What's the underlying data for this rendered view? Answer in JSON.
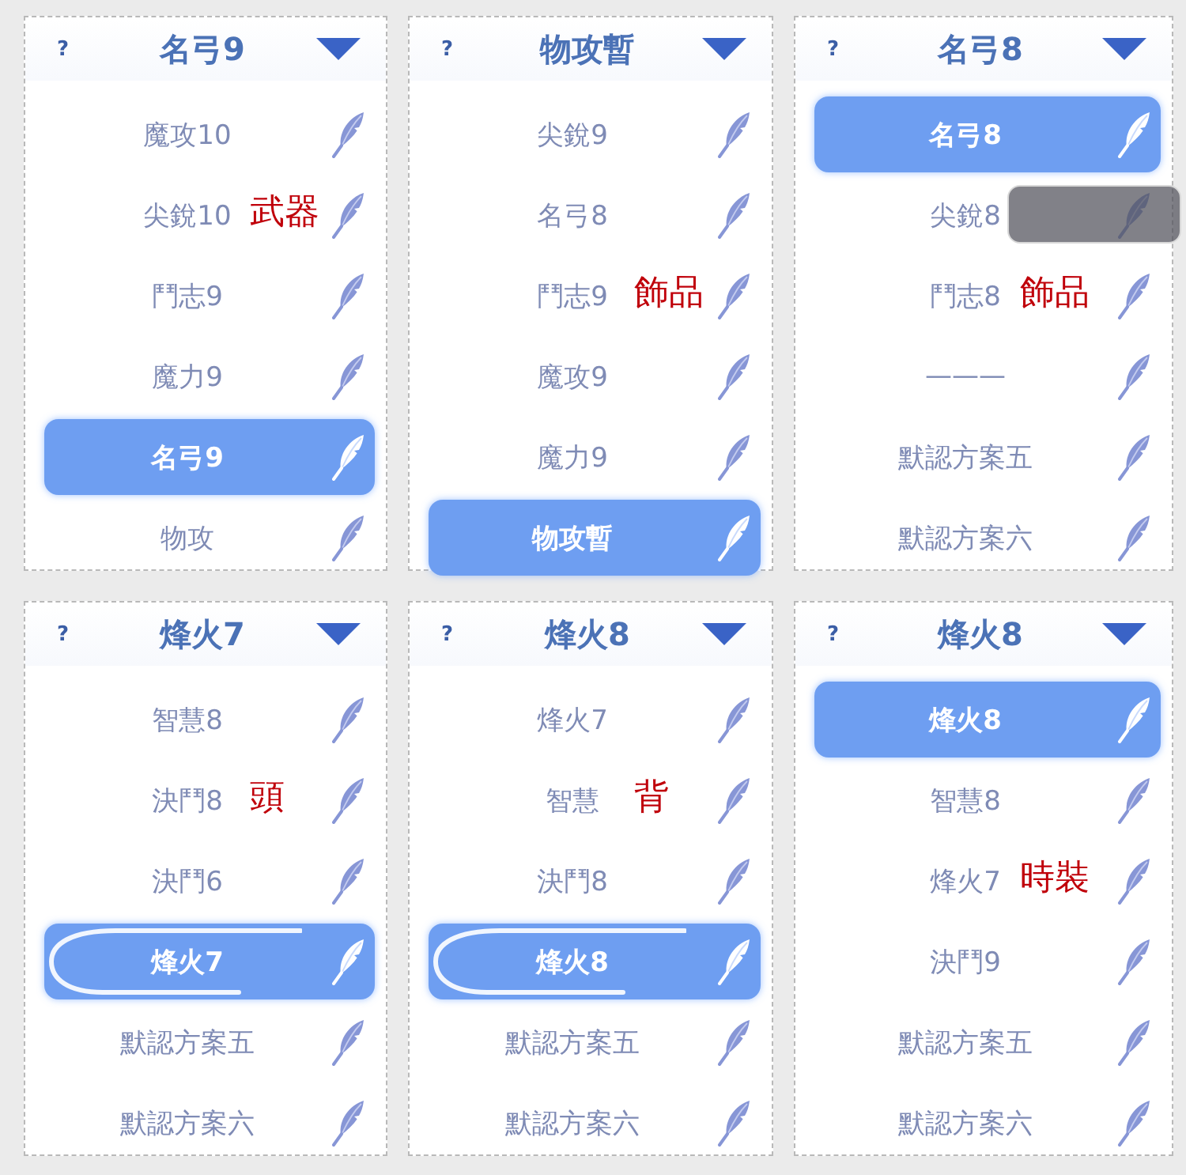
{
  "panels": [
    {
      "help": "?",
      "title": "名弓9",
      "items": [
        {
          "label": "魔攻10",
          "selected": false,
          "shine": false,
          "dragging": false
        },
        {
          "label": "尖銳10",
          "selected": false,
          "shine": false,
          "dragging": false,
          "annotation": "武器"
        },
        {
          "label": "鬥志9",
          "selected": false,
          "shine": false,
          "dragging": false
        },
        {
          "label": "魔力9",
          "selected": false,
          "shine": false,
          "dragging": false
        },
        {
          "label": "名弓9",
          "selected": true,
          "shine": false,
          "dragging": false
        },
        {
          "label": "物攻",
          "selected": false,
          "shine": false,
          "dragging": false
        }
      ]
    },
    {
      "help": "?",
      "title": "物攻暫",
      "items": [
        {
          "label": "尖銳9",
          "selected": false,
          "shine": false,
          "dragging": false
        },
        {
          "label": "名弓8",
          "selected": false,
          "shine": false,
          "dragging": false
        },
        {
          "label": "鬥志9",
          "selected": false,
          "shine": false,
          "dragging": false,
          "annotation": "飾品"
        },
        {
          "label": "魔攻9",
          "selected": false,
          "shine": false,
          "dragging": false
        },
        {
          "label": "魔力9",
          "selected": false,
          "shine": false,
          "dragging": false
        },
        {
          "label": "物攻暫",
          "selected": true,
          "shine": false,
          "dragging": false
        }
      ]
    },
    {
      "help": "?",
      "title": "名弓8",
      "items": [
        {
          "label": "名弓8",
          "selected": true,
          "shine": false,
          "dragging": false
        },
        {
          "label": "尖銳8",
          "selected": false,
          "shine": false,
          "dragging": true
        },
        {
          "label": "鬥志8",
          "selected": false,
          "shine": false,
          "dragging": false,
          "annotation": "飾品"
        },
        {
          "label": "———",
          "selected": false,
          "shine": false,
          "dragging": false
        },
        {
          "label": "默認方案五",
          "selected": false,
          "shine": false,
          "dragging": false
        },
        {
          "label": "默認方案六",
          "selected": false,
          "shine": false,
          "dragging": false
        }
      ]
    },
    {
      "help": "?",
      "title": "烽火7",
      "items": [
        {
          "label": "智慧8",
          "selected": false,
          "shine": false,
          "dragging": false
        },
        {
          "label": "決鬥8",
          "selected": false,
          "shine": false,
          "dragging": false,
          "annotation": "頭"
        },
        {
          "label": "決鬥6",
          "selected": false,
          "shine": false,
          "dragging": false
        },
        {
          "label": "烽火7",
          "selected": true,
          "shine": true,
          "dragging": false
        },
        {
          "label": "默認方案五",
          "selected": false,
          "shine": false,
          "dragging": false
        },
        {
          "label": "默認方案六",
          "selected": false,
          "shine": false,
          "dragging": false
        }
      ]
    },
    {
      "help": "?",
      "title": "烽火8",
      "items": [
        {
          "label": "烽火7",
          "selected": false,
          "shine": false,
          "dragging": false
        },
        {
          "label": "智慧",
          "selected": false,
          "shine": false,
          "dragging": false,
          "annotation": "背"
        },
        {
          "label": "決鬥8",
          "selected": false,
          "shine": false,
          "dragging": false
        },
        {
          "label": "烽火8",
          "selected": true,
          "shine": true,
          "dragging": false
        },
        {
          "label": "默認方案五",
          "selected": false,
          "shine": false,
          "dragging": false
        },
        {
          "label": "默認方案六",
          "selected": false,
          "shine": false,
          "dragging": false
        }
      ]
    },
    {
      "help": "?",
      "title": "烽火8",
      "items": [
        {
          "label": "烽火8",
          "selected": true,
          "shine": false,
          "dragging": false
        },
        {
          "label": "智慧8",
          "selected": false,
          "shine": false,
          "dragging": false
        },
        {
          "label": "烽火7",
          "selected": false,
          "shine": false,
          "dragging": false,
          "annotation": "時裝"
        },
        {
          "label": "決鬥9",
          "selected": false,
          "shine": false,
          "dragging": false
        },
        {
          "label": "默認方案五",
          "selected": false,
          "shine": false,
          "dragging": false
        },
        {
          "label": "默認方案六",
          "selected": false,
          "shine": false,
          "dragging": false
        }
      ]
    }
  ]
}
